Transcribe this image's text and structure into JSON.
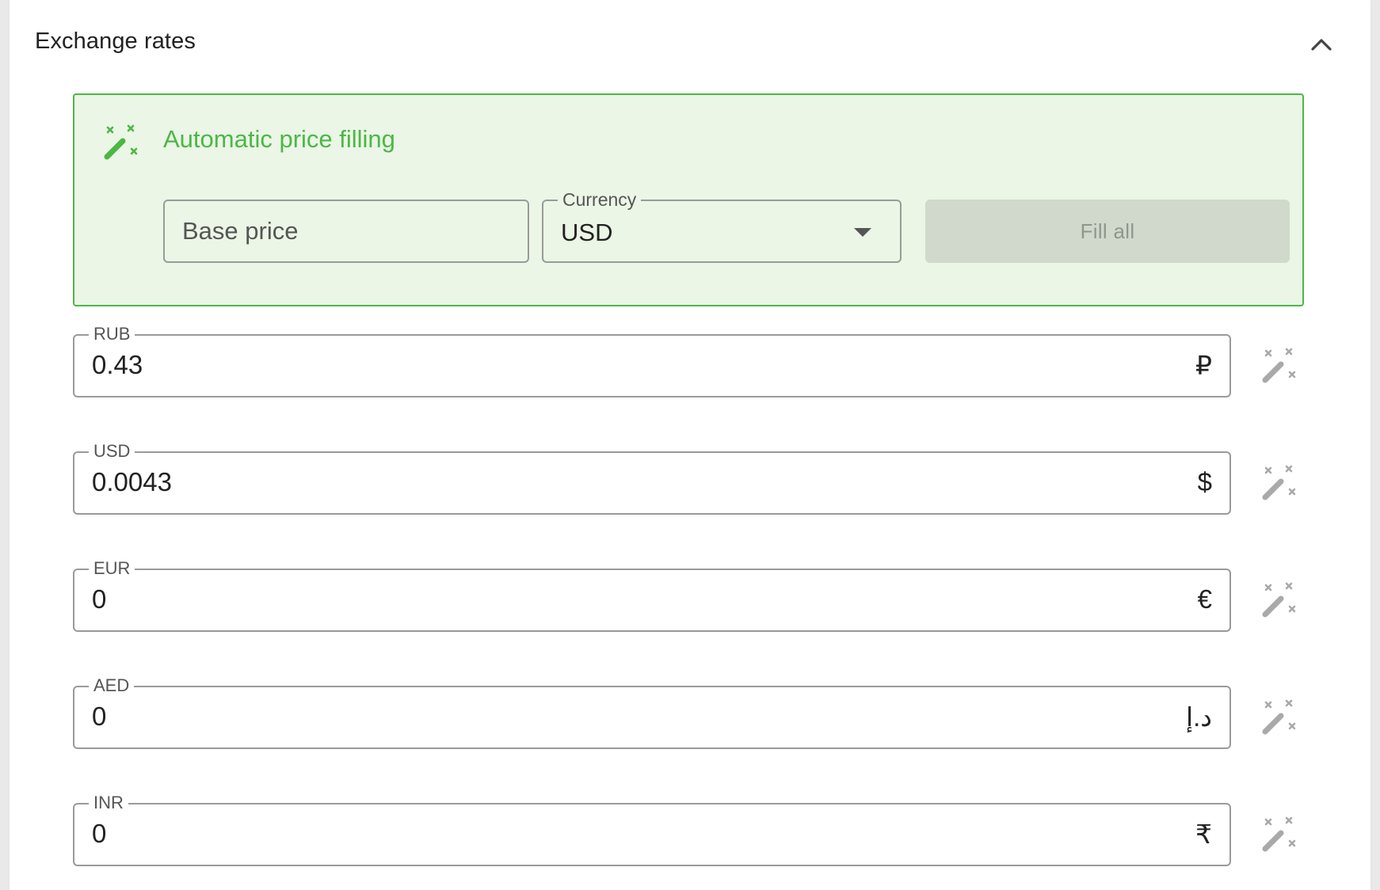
{
  "section": {
    "title": "Exchange rates",
    "collapse_icon": "chevron-up-icon"
  },
  "autofill": {
    "title": "Automatic price filling",
    "icon": "magic-wand-icon",
    "base_price_placeholder": "Base price",
    "base_price_value": "",
    "currency_label": "Currency",
    "currency_value": "USD",
    "fill_all_label": "Fill all"
  },
  "rates": [
    {
      "code": "RUB",
      "value": "0.43",
      "symbol": "₽"
    },
    {
      "code": "USD",
      "value": "0.0043",
      "symbol": "$"
    },
    {
      "code": "EUR",
      "value": "0",
      "symbol": "€"
    },
    {
      "code": "AED",
      "value": "0",
      "symbol": "د.إ"
    },
    {
      "code": "INR",
      "value": "0",
      "symbol": "₹"
    }
  ],
  "colors": {
    "accent": "#4cb746",
    "accent_bg": "#ebf6e6",
    "disabled_bg": "#d0d9cc",
    "icon_gray": "#a9a9a9"
  }
}
